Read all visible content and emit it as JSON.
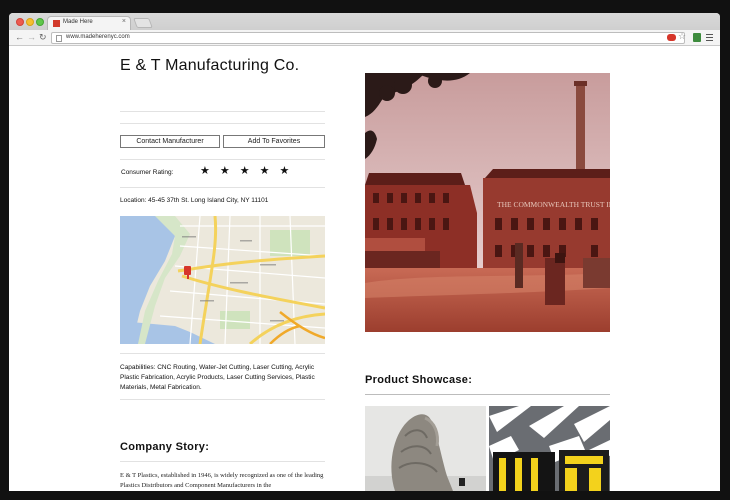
{
  "browser": {
    "tab_title": "Made Here",
    "tab_close": "×",
    "url": "www.madeherenyc.com"
  },
  "profile": {
    "company_name": "E & T Manufacturing Co.",
    "contact_button": "Contact Manufacturer",
    "favorites_button": "Add To Favorites",
    "rating_label": "Consumer Rating:",
    "rating": 5,
    "rating_max": 5,
    "rating_stars": "★★★★★",
    "location": "Location: 45-45 37th St. Long Island City, NY 11101",
    "capabilities": "Capabilities: CNC Routing, Water-Jet Cutting, Laser Cutting, Acrylic Plastic Fabrication, Acrylic Products, Laser Cutting Services, Plastic Materials, Metal Fabrication.",
    "story_title": "Company Story:",
    "story_text": "E & T Plastics, established in 1946, is widely recognized as one of the leading Plastics Distributors and Component Manufacturers in the"
  },
  "photo": {
    "sign_text": "THE COMMONWEALTH TRUST INDIA"
  },
  "showcase": {
    "title": "Product Showcase:"
  },
  "colors": {
    "accent_red": "#d6362a",
    "brick": "#8d2f26",
    "map_road_yellow": "#f4d25c",
    "map_water": "#a8c4e6"
  }
}
